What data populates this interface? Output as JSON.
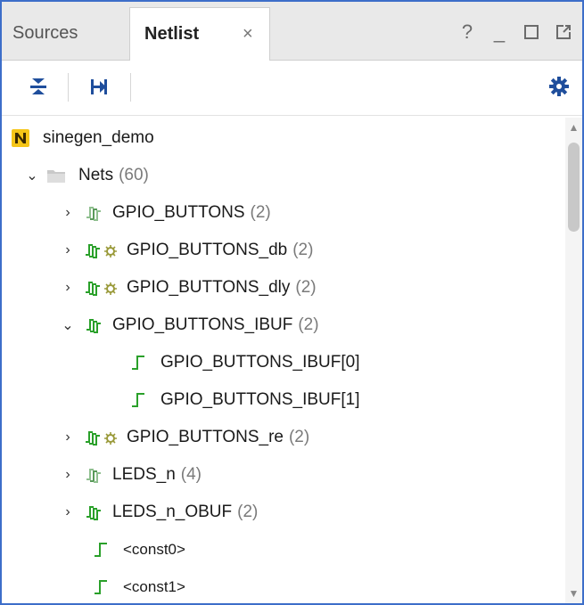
{
  "tabs": {
    "sources": "Sources",
    "netlist": "Netlist",
    "close": "×"
  },
  "window_controls": {
    "help": "?",
    "minimize": "_"
  },
  "tree": {
    "root": {
      "label": "sinegen_demo"
    },
    "nets_folder": {
      "label": "Nets",
      "count": "(60)"
    },
    "rows": [
      {
        "label": "GPIO_BUTTONS",
        "count": "(2)",
        "icon": "bus-net-icon"
      },
      {
        "label": "GPIO_BUTTONS_db",
        "count": "(2)",
        "icon": "bus-net-cell-icon"
      },
      {
        "label": "GPIO_BUTTONS_dly",
        "count": "(2)",
        "icon": "bus-net-cell-icon"
      },
      {
        "label": "GPIO_BUTTONS_IBUF",
        "count": "(2)",
        "icon": "bus-net-green-icon"
      },
      {
        "label": "GPIO_BUTTONS_IBUF[0]",
        "count": "",
        "icon": "net-icon"
      },
      {
        "label": "GPIO_BUTTONS_IBUF[1]",
        "count": "",
        "icon": "net-icon"
      },
      {
        "label": "GPIO_BUTTONS_re",
        "count": "(2)",
        "icon": "bus-net-cell-icon"
      },
      {
        "label": "LEDS_n",
        "count": "(4)",
        "icon": "bus-net-icon"
      },
      {
        "label": "LEDS_n_OBUF",
        "count": "(2)",
        "icon": "bus-net-green-icon"
      },
      {
        "label": "<const0>",
        "count": "",
        "icon": "net-icon"
      },
      {
        "label": "<const1>",
        "count": "",
        "icon": "net-icon"
      }
    ]
  },
  "colors": {
    "frame_border": "#3d6ec9",
    "net_green": "#2aa02a",
    "toolbar_icon_blue": "#1f4e9c"
  }
}
